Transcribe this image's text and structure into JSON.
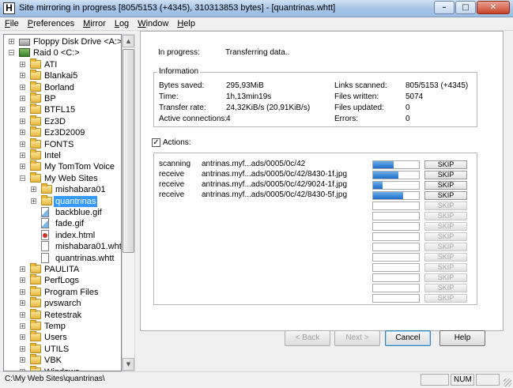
{
  "window": {
    "title": "Site mirroring in progress [805/5153 (+4345), 310313853 bytes] - [quantrinas.whtt]",
    "app_icon": "H",
    "controls": {
      "minimize": "–",
      "maximize": "□",
      "close": "✕"
    }
  },
  "menu": [
    "File",
    "Preferences",
    "Mirror",
    "Log",
    "Window",
    "Help"
  ],
  "tree": [
    {
      "label": "Floppy Disk Drive <A:>",
      "icon": "drive-icon",
      "level": 0,
      "expander": "+"
    },
    {
      "label": "Raid 0 <C:>",
      "icon": "raid-icon",
      "level": 0,
      "expander": "−"
    },
    {
      "label": "ATI",
      "icon": "folder-icon",
      "level": 1,
      "expander": "+"
    },
    {
      "label": "Blankai5",
      "icon": "folder-icon",
      "level": 1,
      "expander": "+"
    },
    {
      "label": "Borland",
      "icon": "folder-icon",
      "level": 1,
      "expander": "+"
    },
    {
      "label": "BP",
      "icon": "folder-icon",
      "level": 1,
      "expander": "+"
    },
    {
      "label": "BTFL15",
      "icon": "folder-icon",
      "level": 1,
      "expander": "+"
    },
    {
      "label": "Ez3D",
      "icon": "folder-icon",
      "level": 1,
      "expander": "+"
    },
    {
      "label": "Ez3D2009",
      "icon": "folder-icon",
      "level": 1,
      "expander": "+"
    },
    {
      "label": "FONTS",
      "icon": "folder-icon",
      "level": 1,
      "expander": "+"
    },
    {
      "label": "Intel",
      "icon": "folder-icon",
      "level": 1,
      "expander": "+"
    },
    {
      "label": "My TomTom Voice",
      "icon": "folder-icon",
      "level": 1,
      "expander": "+"
    },
    {
      "label": "My Web Sites",
      "icon": "folder-icon",
      "level": 1,
      "expander": "−"
    },
    {
      "label": "mishabara01",
      "icon": "folder-icon",
      "level": 2,
      "expander": "+"
    },
    {
      "label": "quantrinas",
      "icon": "folder-icon",
      "level": 2,
      "expander": "+",
      "selected": true
    },
    {
      "label": "backblue.gif",
      "icon": "gif-icon",
      "level": 2,
      "expander": ""
    },
    {
      "label": "fade.gif",
      "icon": "gif-icon",
      "level": 2,
      "expander": ""
    },
    {
      "label": "index.html",
      "icon": "html-icon",
      "level": 2,
      "expander": ""
    },
    {
      "label": "mishabara01.whtt",
      "icon": "file-icon",
      "level": 2,
      "expander": ""
    },
    {
      "label": "quantrinas.whtt",
      "icon": "file-icon",
      "level": 2,
      "expander": ""
    },
    {
      "label": "PAULITA",
      "icon": "folder-icon",
      "level": 1,
      "expander": "+"
    },
    {
      "label": "PerfLogs",
      "icon": "folder-icon",
      "level": 1,
      "expander": "+"
    },
    {
      "label": "Program Files",
      "icon": "folder-icon",
      "level": 1,
      "expander": "+"
    },
    {
      "label": "pvswarch",
      "icon": "folder-icon",
      "level": 1,
      "expander": "+"
    },
    {
      "label": "Retestrak",
      "icon": "folder-icon",
      "level": 1,
      "expander": "+"
    },
    {
      "label": "Temp",
      "icon": "folder-icon",
      "level": 1,
      "expander": "+"
    },
    {
      "label": "Users",
      "icon": "folder-icon",
      "level": 1,
      "expander": "+"
    },
    {
      "label": "UTILS",
      "icon": "folder-icon",
      "level": 1,
      "expander": "+"
    },
    {
      "label": "VBK",
      "icon": "folder-icon",
      "level": 1,
      "expander": "+"
    },
    {
      "label": "Windows",
      "icon": "folder-icon",
      "level": 1,
      "expander": "+"
    }
  ],
  "progress": {
    "label": "In progress:",
    "value": "Transferring data.."
  },
  "info": {
    "group_label": "Information",
    "left": [
      {
        "label": "Bytes saved:",
        "value": "295,93MiB"
      },
      {
        "label": "Time:",
        "value": "1h,13min19s"
      },
      {
        "label": "Transfer rate:",
        "value": "24,32KiB/s (20,91KiB/s)"
      },
      {
        "label": "Active connections:",
        "value": "4"
      }
    ],
    "right": [
      {
        "label": "Links scanned:",
        "value": "805/5153 (+4345)"
      },
      {
        "label": "Files written:",
        "value": "5074"
      },
      {
        "label": "Files updated:",
        "value": "0"
      },
      {
        "label": "Errors:",
        "value": "0"
      }
    ]
  },
  "actions": {
    "checkbox_mark": "✓",
    "label": "Actions:",
    "skip_label": "SKIP",
    "rows": [
      {
        "status": "scanning",
        "url": "antrinas.myf...ads/0005/0c/42",
        "progress": 0.45
      },
      {
        "status": "receive",
        "url": "antrinas.myf...ads/0005/0c/42/8430-1f.jpg",
        "progress": 0.55
      },
      {
        "status": "receive",
        "url": "antrinas.myf...ads/0005/0c/42/9024-1f.jpg",
        "progress": 0.2
      },
      {
        "status": "receive",
        "url": "antrinas.myf...ads/0005/0c/42/8430-5f.jpg",
        "progress": 0.65
      },
      {
        "status": "",
        "url": "",
        "progress": 0
      },
      {
        "status": "",
        "url": "",
        "progress": 0
      },
      {
        "status": "",
        "url": "",
        "progress": 0
      },
      {
        "status": "",
        "url": "",
        "progress": 0
      },
      {
        "status": "",
        "url": "",
        "progress": 0
      },
      {
        "status": "",
        "url": "",
        "progress": 0
      },
      {
        "status": "",
        "url": "",
        "progress": 0
      },
      {
        "status": "",
        "url": "",
        "progress": 0
      },
      {
        "status": "",
        "url": "",
        "progress": 0
      },
      {
        "status": "",
        "url": "",
        "progress": 0
      }
    ]
  },
  "buttons": {
    "back": "< Back",
    "next": "Next >",
    "cancel": "Cancel",
    "help": "Help"
  },
  "status": {
    "path": "C:\\My Web Sites\\quantrinas\\",
    "num": "NUM"
  }
}
